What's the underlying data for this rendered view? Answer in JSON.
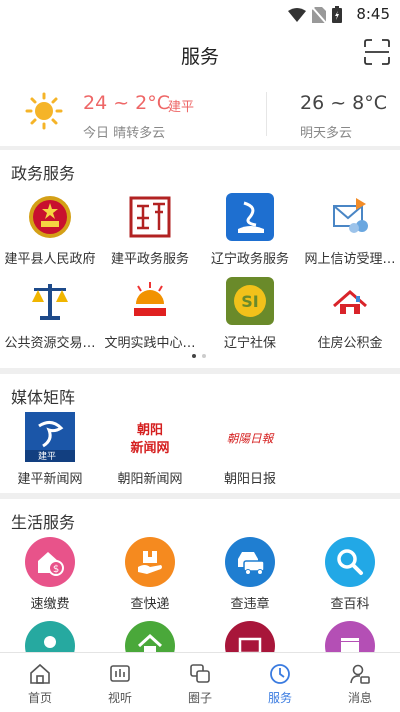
{
  "status_bar": {
    "time": "8:45"
  },
  "header": {
    "title": "服务"
  },
  "weather": {
    "today_temp": "24 ~ 2°C",
    "city": "建平",
    "today_desc": "今日 晴转多云",
    "tomorrow_temp": "26 ~ 8°C",
    "tomorrow_desc": "明天多云"
  },
  "gov": {
    "title": "政务服务",
    "items": [
      {
        "label": "建平县人民政府"
      },
      {
        "label": "建平政务服务"
      },
      {
        "label": "辽宁政务服务"
      },
      {
        "label": "网上信访受理…"
      },
      {
        "label": "公共资源交易…"
      },
      {
        "label": "文明实践中心…"
      },
      {
        "label": "辽宁社保"
      },
      {
        "label": "住房公积金"
      }
    ],
    "page_dots": 2,
    "active_dot": 1
  },
  "media": {
    "title": "媒体矩阵",
    "items": [
      {
        "label": "建平新闻网",
        "logo_text": "建平"
      },
      {
        "label": "朝阳新闻网",
        "logo_text": "朝阳\n新闻网"
      },
      {
        "label": "朝阳日报",
        "logo_text": "朝陽日報"
      }
    ]
  },
  "life": {
    "title": "生活服务",
    "items": [
      {
        "label": "速缴费",
        "color": "#e8538a"
      },
      {
        "label": "查快递",
        "color": "#f58a1f"
      },
      {
        "label": "查违章",
        "color": "#1f7ed1"
      },
      {
        "label": "查百科",
        "color": "#22a8e6"
      }
    ],
    "partial_colors": [
      "#26a9a0",
      "#4aa83a",
      "#a8163a",
      "#b44fb5"
    ]
  },
  "tabs": [
    {
      "label": "首页"
    },
    {
      "label": "视听"
    },
    {
      "label": "圈子"
    },
    {
      "label": "服务",
      "active": true
    },
    {
      "label": "消息"
    }
  ],
  "colors": {
    "accent": "#3a7be0",
    "temp_today": "#e66666"
  }
}
